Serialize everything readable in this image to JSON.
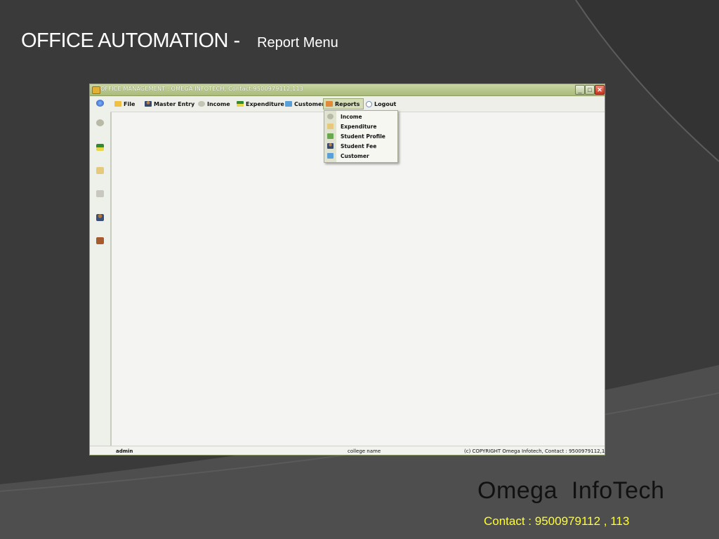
{
  "slide": {
    "title": "OFFICE AUTOMATION -",
    "subtitle": "Report Menu",
    "brand": "Omega  InfoTech",
    "contact": "Contact : 9500979112 , 113"
  },
  "window": {
    "title": "OFFICE MANAGEMENT : OMEGA INFOTECH, Contact:9500979112,113",
    "controls": [
      "minimize",
      "maximize",
      "close"
    ]
  },
  "menu": {
    "items": [
      {
        "label": "File",
        "icon": "folder-icon"
      },
      {
        "label": "Master Entry",
        "icon": "user-icon"
      },
      {
        "label": "Income",
        "icon": "money-bag-icon"
      },
      {
        "label": "Expenditure",
        "icon": "card-icon"
      },
      {
        "label": "Customer",
        "icon": "customer-icon"
      },
      {
        "label": "Reports",
        "icon": "report-icon",
        "active": true
      },
      {
        "label": "Logout",
        "icon": "logout-icon"
      }
    ]
  },
  "reports_dropdown": {
    "items": [
      {
        "label": "Income",
        "icon": "income-report-icon"
      },
      {
        "label": "Expenditure",
        "icon": "expenditure-report-icon"
      },
      {
        "label": "Student Profile",
        "icon": "student-profile-icon"
      },
      {
        "label": "Student Fee",
        "icon": "student-fee-icon"
      },
      {
        "label": "Customer",
        "icon": "customer-report-icon"
      }
    ]
  },
  "sidebar": {
    "icons": [
      "globe-icon",
      "money-bag-icon",
      "card-icon",
      "folder-icon",
      "printer-icon",
      "user-icon",
      "exit-door-icon"
    ]
  },
  "status": {
    "user": "admin",
    "college": "college name",
    "copyright": "(c) COPYRIGHT Omega Infotech, Contact : 9500979112,113"
  },
  "colors": {
    "background": "#3a3a3a",
    "contact_text": "#ffff33",
    "titlebar": "#b5c48a"
  }
}
